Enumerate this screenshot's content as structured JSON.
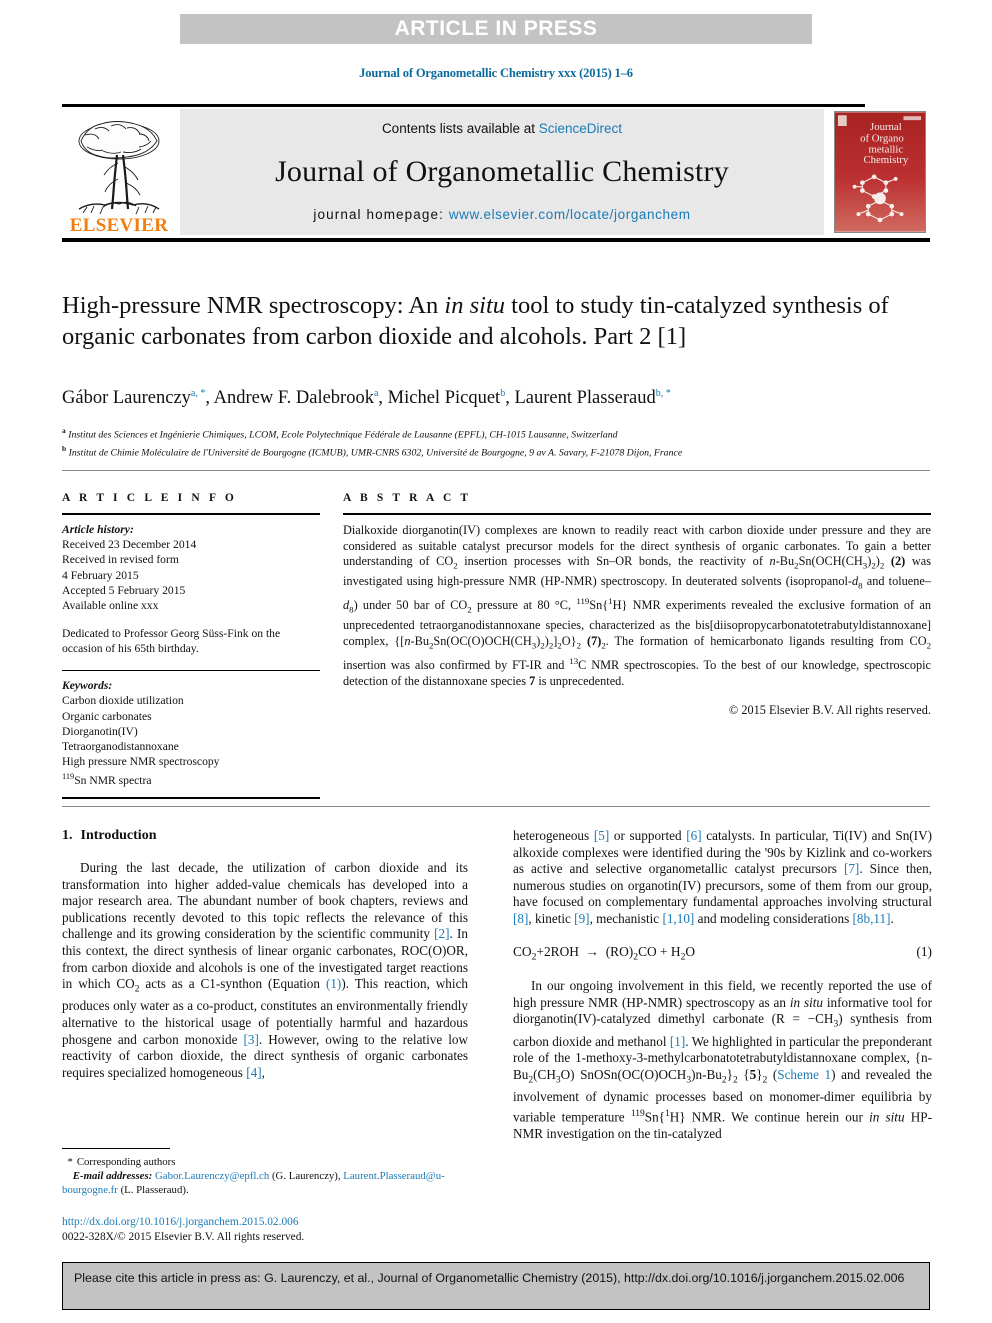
{
  "banner": {
    "text": "ARTICLE IN PRESS"
  },
  "journal_ref": "Journal of Organometallic Chemistry xxx (2015) 1–6",
  "masthead": {
    "contents_prefix": "Contents lists available at ",
    "sciencedirect": "ScienceDirect",
    "journal_title": "Journal of Organometallic Chemistry",
    "homepage_label": "journal homepage: ",
    "homepage_url": "www.elsevier.com/locate/jorganchem",
    "publisher": "ELSEVIER",
    "cover_title_lines": [
      "Journal",
      "of Organo",
      "metallic",
      "Chemistry"
    ]
  },
  "article": {
    "title_line1_a": "High-pressure NMR spectroscopy: An ",
    "title_line1_i": "in situ",
    "title_line1_b": " tool to study",
    "title_line2": "tin-catalyzed synthesis of organic carbonates from carbon dioxide",
    "title_line3": "and alcohols. Part 2 [1]",
    "authors": [
      {
        "name": "Gábor Laurenczy",
        "marks": "a, *",
        "sep": ", "
      },
      {
        "name": "Andrew F. Dalebrook",
        "marks": "a",
        "sep": ", "
      },
      {
        "name": "Michel Picquet",
        "marks": "b",
        "sep": ", "
      },
      {
        "name": "Laurent Plasseraud",
        "marks": "b, *",
        "sep": ""
      }
    ],
    "affiliations": [
      {
        "mark": "a",
        "text": "Institut des Sciences et Ingénierie Chimiques, LCOM, Ecole Polytechnique Fédérale de Lausanne (EPFL), CH-1015 Lausanne, Switzerland"
      },
      {
        "mark": "b",
        "text": "Institut de Chimie Moléculaire de l'Université de Bourgogne (ICMUB), UMR-CNRS 6302, Université de Bourgogne, 9 av A. Savary, F-21078 Dijon, France"
      }
    ]
  },
  "info": {
    "heading": "A R T I C L E   I N F O",
    "history_label": "Article history:",
    "history": [
      "Received 23 December 2014",
      "Received in revised form",
      "4 February 2015",
      "Accepted 5 February 2015",
      "Available online xxx"
    ],
    "dedication": "Dedicated to Professor Georg Süss-Fink on the occasion of his 65th birthday.",
    "keywords_label": "Keywords:",
    "keywords": [
      "Carbon dioxide utilization",
      "Organic carbonates",
      "Diorganotin(IV)",
      "Tetraorganodistannoxane",
      "High pressure NMR spectroscopy"
    ],
    "keyword_last_sup": "119",
    "keyword_last_rest": "Sn NMR spectra"
  },
  "abstract": {
    "heading": "A B S T R A C T",
    "text": "Dialkoxide diorganotin(IV) complexes are known to readily react with carbon dioxide under pressure and they are considered as suitable catalyst precursor models for the direct synthesis of organic carbonates. To gain a better understanding of CO2 insertion processes with Sn–OR bonds, the reactivity of n-Bu2Sn(OCH(CH3)2)2 (2) was investigated using high-pressure NMR (HP-NMR) spectroscopy. In deuterated solvents (isopropanol-d8 and toluene–d8) under 50 bar of CO2 pressure at 80 °C, 119Sn{1H} NMR experiments revealed the exclusive formation of an unprecedented tetraorganodistannoxane species, characterized as the bis[diisopropycarbonatotetrabutyldistannoxane] complex, {[n-Bu2Sn(OC(O)OCH(CH3)2)2]2O}2 (7)2. The formation of hemicarbonato ligands resulting from CO2 insertion was also confirmed by FT-IR and 13C NMR spectroscopies. To the best of our knowledge, spectroscopic detection of the distannoxane species 7 is unprecedented.",
    "copyright": "© 2015 Elsevier B.V. All rights reserved."
  },
  "body": {
    "section_number": "1.",
    "section_title": "Introduction",
    "left_paragraphs": [
      "During the last decade, the utilization of carbon dioxide and its transformation into higher added-value chemicals has developed into a major research area. The abundant number of book chapters, reviews and publications recently devoted to this topic reflects the relevance of this challenge and its growing consideration by the scientific community [2]. In this context, the direct synthesis of linear organic carbonates, ROC(O)OR, from carbon dioxide and alcohols is one of the investigated target reactions in which CO2 acts as a C1-synthon (Equation (1)). This reaction, which produces only water as a co-product, constitutes an environmentally friendly alternative to the historical usage of potentially harmful and hazardous phosgene and carbon monoxide [3]. However, owing to the relative low reactivity of carbon dioxide, the direct synthesis of organic carbonates requires specialized homogeneous [4],"
    ],
    "right_paragraph_1": "heterogeneous [5] or supported [6] catalysts. In particular, Ti(IV) and Sn(IV) alkoxide complexes were identified during the '90s by Kizlink and co-workers as active and selective organometallic catalyst precursors [7]. Since then, numerous studies on organotin(IV) precursors, some of them from our group, have focused on complementary fundamental approaches involving structural [8], kinetic [9], mechanistic [1,10] and modeling considerations [8b,11].",
    "equation": "CO2+2ROH → (RO)2CO + H2O",
    "equation_number": "(1)",
    "right_paragraph_2": "In our ongoing involvement in this field, we recently reported the use of high pressure NMR (HP-NMR) spectroscopy as an in situ informative tool for diorganotin(IV)-catalyzed dimethyl carbonate (R = −CH3) synthesis from carbon dioxide and methanol [1]. We highlighted in particular the preponderant role of the 1-methoxy-3-methylcarbonatotetrabutyldistannoxane complex, {n-Bu2(CH3O) SnOSn(OC(O)OCH3)n-Bu2}2 {5}2 (Scheme 1) and revealed the involvement of dynamic processes based on monomer-dimer equilibria by variable temperature 119Sn{1H} NMR. We continue herein our in situ HP-NMR investigation on the tin-catalyzed"
  },
  "footnote": {
    "star": "*",
    "corresponding": "Corresponding authors",
    "email_label": "E-mail addresses:",
    "email1": "Gabor.Laurenczy@epfl.ch",
    "email1_owner": "(G. Laurenczy),",
    "email2a": "Laurent.Plasseraud@",
    "email2b": "u-bourgogne.fr",
    "email2_owner": "(L. Plasseraud)."
  },
  "doi": {
    "url": "http://dx.doi.org/10.1016/j.jorganchem.2015.02.006",
    "issn": "0022-328X/© 2015 Elsevier B.V. All rights reserved."
  },
  "citation_footer": {
    "text": "Please cite this article in press as: G. Laurenczy, et al., Journal of Organometallic Chemistry (2015), http://dx.doi.org/10.1016/j.jorganchem.2015.02.006"
  },
  "colors": {
    "link_blue": "#1a7ab5",
    "ref_blue": "#0b6a9c",
    "elsevier_orange": "#F07F13",
    "band_gray": "#c3c3c3",
    "masthead_gray": "#e8e8e8",
    "cover_red": "#b52b2b"
  }
}
